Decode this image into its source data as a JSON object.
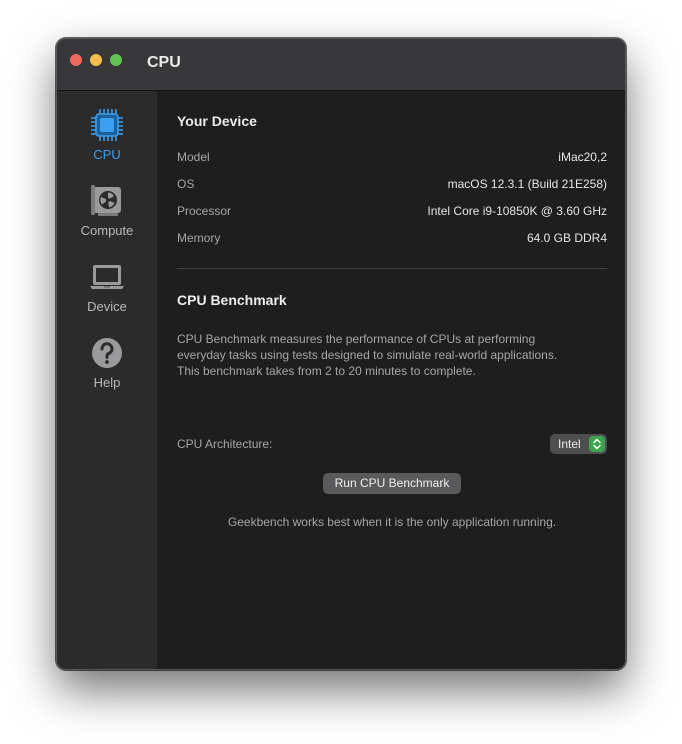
{
  "window": {
    "title": "CPU"
  },
  "sidebar": {
    "items": [
      {
        "label": "CPU",
        "icon": "cpu-chip-icon",
        "active": true
      },
      {
        "label": "Compute",
        "icon": "gpu-card-icon",
        "active": false
      },
      {
        "label": "Device",
        "icon": "laptop-icon",
        "active": false
      },
      {
        "label": "Help",
        "icon": "question-mark-icon",
        "active": false
      }
    ]
  },
  "device": {
    "heading": "Your Device",
    "rows": [
      {
        "label": "Model",
        "value": "iMac20,2"
      },
      {
        "label": "OS",
        "value": "macOS 12.3.1 (Build 21E258)"
      },
      {
        "label": "Processor",
        "value": "Intel Core i9-10850K @ 3.60 GHz"
      },
      {
        "label": "Memory",
        "value": "64.0 GB DDR4"
      }
    ]
  },
  "benchmark": {
    "heading": "CPU Benchmark",
    "description_lines": [
      "CPU Benchmark measures the performance of CPUs at performing",
      "everyday tasks using tests designed to simulate real-world applications.",
      "This benchmark takes from 2 to 20 minutes to complete."
    ],
    "architecture_label": "CPU Architecture:",
    "architecture_value": "Intel",
    "run_button": "Run CPU Benchmark",
    "note": "Geekbench works best when it is the only application running."
  },
  "colors": {
    "accent": "#3a9ff0",
    "stepper": "#3fa34d"
  }
}
